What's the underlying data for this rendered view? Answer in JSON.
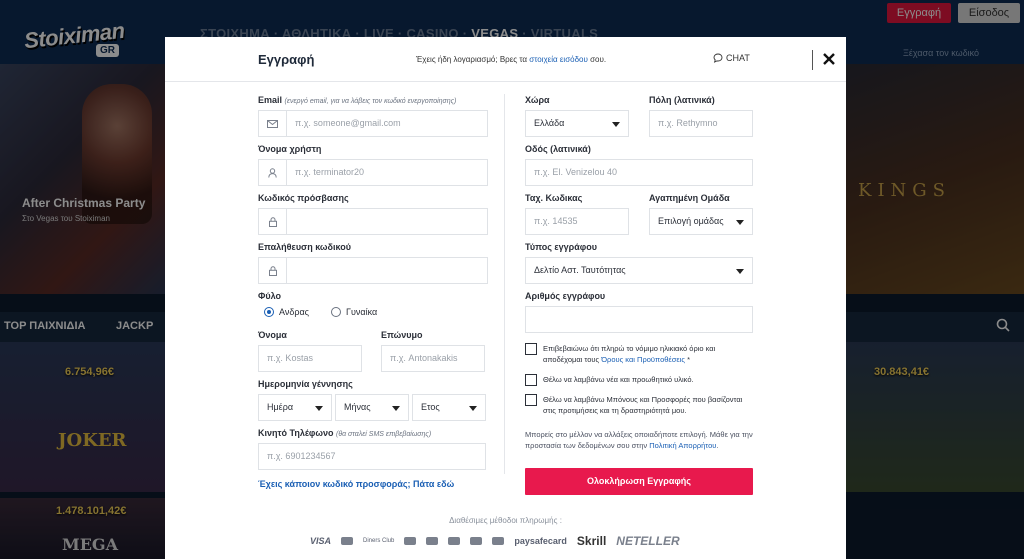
{
  "background": {
    "logo_text": "Stoiximan",
    "logo_badge": "GR",
    "nav_text": "ΣΤΟΙΧΗΜΑ · ΑΘΛΗΤΙΚΑ · LIVE · CASINO · ",
    "nav_highlight": "VEGAS",
    "nav_tail": " · VIRTUALS",
    "register_label": "Εγγραφή",
    "login_label": "Είσοδος",
    "forgot_text": "Ξέχασα τον κωδικό",
    "hero_title": "After Christmas Party",
    "hero_subtitle": "Στο Vegas του Stoiximan",
    "hero_right_text": "KINGS",
    "category_top": "TOP ΠΑΙΧΝΙΔΙΑ",
    "category_jackpot": "JACKP",
    "jackpot_1": "6.754,96€",
    "jackpot_2": "30.843,41€",
    "jackpot_3": "1.478.101,42€",
    "game_left_label": "JOKER",
    "game_bottom_label": "MEGA"
  },
  "modal": {
    "title": "Εγγραφή",
    "have_account_prefix": "Έχεις ήδη λογαριασμό; Βρες τα ",
    "have_account_link": "στοιχεία εισόδου",
    "have_account_suffix": " σου.",
    "chat_label": "CHAT"
  },
  "form": {
    "email_label": "Email",
    "email_hint": "(ενεργό email, για να λάβεις τον κωδικό ενεργοποίησης)",
    "email_placeholder": "π.χ. someone@gmail.com",
    "username_label": "Όνομα χρήστη",
    "username_placeholder": "π.χ. terminator20",
    "password_label": "Κωδικός πρόσβασης",
    "password_confirm_label": "Επαλήθευση κωδικού",
    "gender_label": "Φύλο",
    "gender_male": "Ανδρας",
    "gender_female": "Γυναίκα",
    "gender_selected": "male",
    "first_name_label": "Όνομα",
    "first_name_placeholder": "π.χ. Kostas",
    "last_name_label": "Επώνυμο",
    "last_name_placeholder": "π.χ. Antonakakis",
    "dob_label": "Ημερομηνία γέννησης",
    "dob_day": "Ημέρα",
    "dob_month": "Μήνας",
    "dob_year": "Ετος",
    "phone_label": "Κινητό Τηλέφωνο",
    "phone_hint": "(θα σταλεί SMS επιβεβαίωσης)",
    "phone_placeholder": "π.χ. 6901234567",
    "promo_link": "Έχεις κάποιον κωδικό προσφοράς; Πάτα εδώ",
    "country_label": "Χώρα",
    "country_value": "Ελλάδα",
    "city_label": "Πόλη (λατινικά)",
    "city_placeholder": "π.χ. Rethymno",
    "street_label": "Οδός (λατινικά)",
    "street_placeholder": "π.χ. El. Venizelou 40",
    "postcode_label": "Ταχ. Κωδικας",
    "postcode_placeholder": "π.χ. 14535",
    "team_label": "Αγαπημένη Ομάδα",
    "team_value": "Επιλογή ομάδας",
    "doc_type_label": "Τύπος εγγράφου",
    "doc_type_value": "Δελτίο Αστ. Ταυτότητας",
    "doc_number_label": "Αριθμός εγγράφου",
    "check_terms_prefix": "Επιβεβαιώνω ότι πληρώ το νόμιμο ηλικιακό όριο και αποδέχομαι τους ",
    "check_terms_link": "Όρους και Προϋποθέσεις",
    "check_terms_suffix": " *",
    "check_news": "Θέλω να λαμβάνω νέα και προωθητικό υλικό.",
    "check_bonus": "Θέλω να λαμβάνω Μπόνους και Προσφορές που βασίζονται στις προτιμήσεις και τη δραστηριότητά μου.",
    "privacy_prefix": "Μπορείς στο μέλλον να αλλάξεις οποιαδήποτε επιλογή. Μάθε για την προστασία των δεδομένων σου στην ",
    "privacy_link": "Πολιτική Απορρήτου",
    "privacy_suffix": ".",
    "submit_label": "Ολοκλήρωση Εγγραφής"
  },
  "payments": {
    "title": "Διαθέσιμες μέθοδοι πληρωμής :",
    "methods": [
      "VISA",
      "Diners Club",
      "paysafecard",
      "Skrill",
      "NETELLER"
    ]
  },
  "colors": {
    "accent_red": "#e8194d",
    "link_blue": "#1a5fb4",
    "header_navy": "#0e2c54"
  }
}
